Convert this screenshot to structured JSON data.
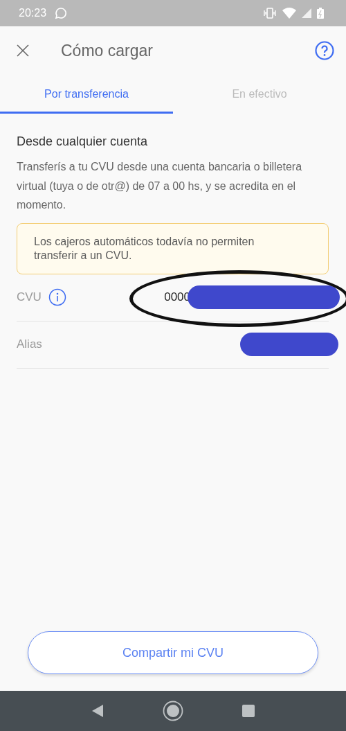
{
  "status_bar": {
    "time": "20:23"
  },
  "header": {
    "title": "Cómo cargar"
  },
  "tabs": [
    {
      "label": "Por transferencia",
      "selected": true
    },
    {
      "label": "En efectivo",
      "selected": false
    }
  ],
  "section": {
    "title": "Desde cualquier cuenta",
    "description": "Transferís a tu CVU desde una cuenta bancaria o billetera virtual (tuya o de otr@) de 07 a 00 hs, y se acredita en el momento."
  },
  "warning": {
    "text": "Los cajeros automáticos todavía no permiten transferir a un CVU."
  },
  "fields": [
    {
      "label": "CVU",
      "info": true,
      "value": "0000",
      "circled": true
    },
    {
      "label": "Alias",
      "info": false,
      "circled": false
    }
  ],
  "share_button": {
    "label": "Compartir mi CVU"
  }
}
